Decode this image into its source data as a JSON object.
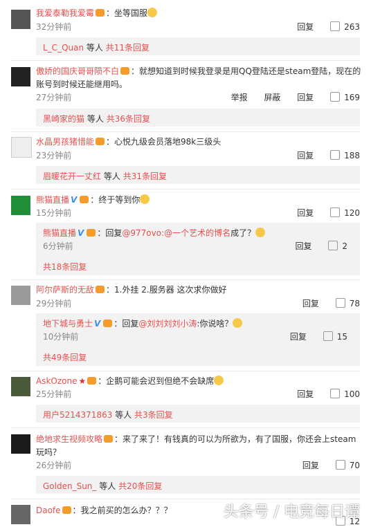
{
  "comments": [
    {
      "username": "我爱泰勒我爱霉",
      "text": "坐等国服",
      "time": "32分钟前",
      "reply_label": "回复",
      "likes": "263",
      "summary_user": "L_C_Quan",
      "summary_mid": "等人",
      "summary_count": "共11条回复"
    },
    {
      "username": "傲娇的国庆哥哥陨不白",
      "text": "就想知道到时候我登录是用QQ登陆还是steam登陆，现在的",
      "text2": "账号到时候还能继用吗。",
      "time": "27分钟前",
      "report_label": "举报",
      "block_label": "屏蔽",
      "reply_label": "回复",
      "likes": "169",
      "summary_user": "黑崎家的猫",
      "summary_mid": "等人",
      "summary_count": "共36条回复"
    },
    {
      "username": "水晶男孩猪惜能",
      "text": "心悦九级会员落地98k三级头",
      "time": "23分钟前",
      "reply_label": "回复",
      "likes": "188",
      "summary_user": "眉暖花开一丈红",
      "summary_mid": "等人",
      "summary_count": "共31条回复"
    },
    {
      "username": "熊猫直播",
      "text": "终于等到你",
      "time": "15分钟前",
      "reply_label": "回复",
      "likes": "120",
      "nested": {
        "username": "熊猫直播",
        "prefix": "回复",
        "mention": "@977ovo:@一个艺术的博名",
        "text": "成了？",
        "time": "6分钟前",
        "reply_label": "回复",
        "likes": "2"
      },
      "summary_count": "共18条回复"
    },
    {
      "username": "阿尔萨斯的无敌",
      "text": "1.外挂 2.服务器 这次求你做好",
      "time": "29分钟前",
      "reply_label": "回复",
      "likes": "78",
      "nested": {
        "username": "地下城与勇士",
        "prefix": "回复",
        "mention": "@刘刘刘刘小涛",
        "text": ":你说啥？",
        "time": "10分钟前",
        "reply_label": "回复",
        "likes": "15"
      },
      "summary_count": "共49条回复"
    },
    {
      "username": "AskOzone",
      "text": "企鹅可能会迟到但绝不会缺席",
      "time": "25分钟前",
      "reply_label": "回复",
      "likes": "100",
      "summary_user": "用户5214371863",
      "summary_mid": "等人",
      "summary_count": "共3条回复"
    },
    {
      "username": "绝地求生视频攻略",
      "text": "来了来了！有钱真的可以为所欲为，有了国服，你还会上steam",
      "text2": "玩吗？",
      "time": "26分钟前",
      "reply_label": "回复",
      "likes": "70",
      "summary_user": "Golden_Sun_",
      "summary_mid": "等人",
      "summary_count": "共20条回复"
    },
    {
      "username": "Daofe",
      "text": "我之前买的怎么办？？？",
      "likes": "12"
    }
  ],
  "watermark": "头条号 / 电竞每日谭",
  "colors": {
    "accent": "#e8504e",
    "box_bg": "#f2f2f2",
    "badge": "#f39b2b",
    "verified": "#3b8ff0"
  }
}
